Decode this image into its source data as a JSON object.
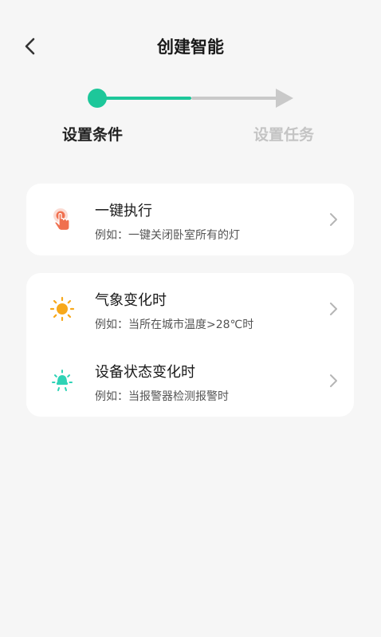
{
  "header": {
    "title": "创建智能",
    "back_icon": "chevron-left-icon"
  },
  "stepper": {
    "steps": [
      {
        "label": "设置条件",
        "state": "active"
      },
      {
        "label": "设置任务",
        "state": "inactive"
      }
    ],
    "active_color": "#1dc79a",
    "inactive_color": "#c9c9c9"
  },
  "conditions": [
    {
      "icon": "tap-hand-icon",
      "icon_color": "#f0704f",
      "title": "一键执行",
      "description": "例如：一键关闭卧室所有的灯"
    },
    {
      "icon": "sun-icon",
      "icon_color": "#f7a81b",
      "title": "气象变化时",
      "description": "例如：当所在城市温度>28℃时"
    },
    {
      "icon": "device-bulb-icon",
      "icon_color": "#2fd3b6",
      "title": "设备状态变化时",
      "description": "例如：当报警器检测报警时"
    }
  ]
}
